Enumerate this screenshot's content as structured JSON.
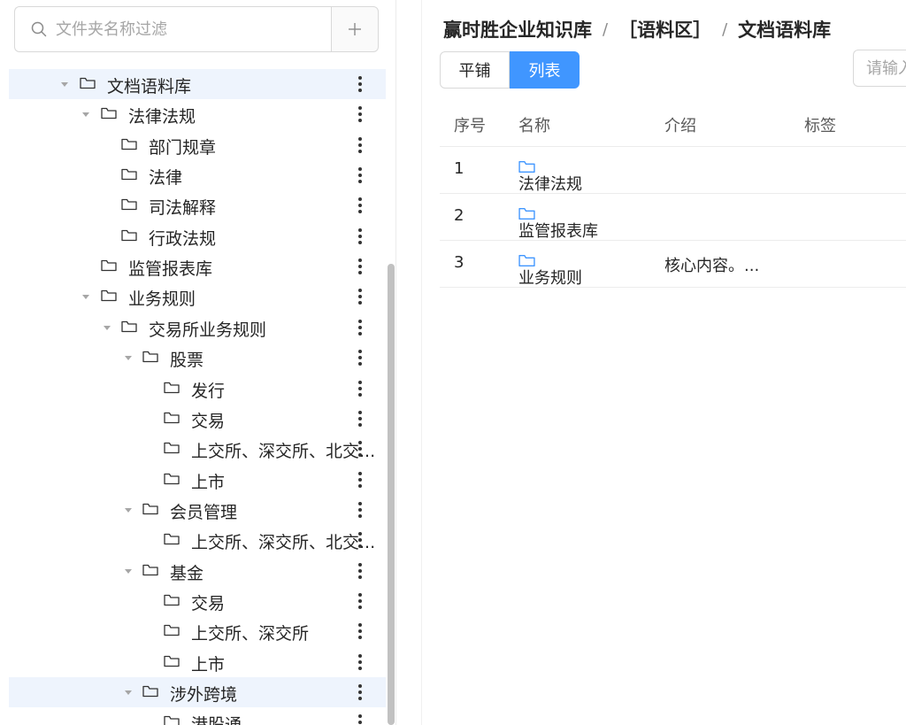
{
  "sidebar": {
    "search_placeholder": "文件夹名称过滤",
    "add_label": "+",
    "tree": [
      {
        "label": "文档语料库",
        "caret": true,
        "selected": true
      },
      {
        "label": "法律法规",
        "caret": true
      },
      {
        "label": "部门规章"
      },
      {
        "label": "法律"
      },
      {
        "label": "司法解释"
      },
      {
        "label": "行政法规"
      },
      {
        "label": "监管报表库"
      },
      {
        "label": "业务规则",
        "caret": true
      },
      {
        "label": "交易所业务规则",
        "caret": true
      },
      {
        "label": "股票",
        "caret": true
      },
      {
        "label": "发行"
      },
      {
        "label": "交易"
      },
      {
        "label": "上交所、深交所、北交...",
        "truncated": true
      },
      {
        "label": "上市"
      },
      {
        "label": "会员管理",
        "caret": true
      },
      {
        "label": "上交所、深交所、北交...",
        "truncated": true
      },
      {
        "label": "基金",
        "caret": true
      },
      {
        "label": "交易"
      },
      {
        "label": "上交所、深交所"
      },
      {
        "label": "上市"
      },
      {
        "label": "涉外跨境",
        "caret": true,
        "selected": true
      },
      {
        "label": "港股通"
      }
    ]
  },
  "main": {
    "breadcrumb": [
      "赢时胜企业知识库",
      "［语料区］",
      "文档语料库"
    ],
    "breadcrumb_sep": "/",
    "view_toggle": {
      "tile": "平铺",
      "list": "列表"
    },
    "filter_placeholder": "请输入",
    "table": {
      "headers": {
        "index": "序号",
        "name": "名称",
        "intro": "介绍",
        "tags": "标签"
      },
      "rows": [
        {
          "index": "1",
          "name": "法律法规",
          "intro": "",
          "tags": ""
        },
        {
          "index": "2",
          "name": "监管报表库",
          "intro": "",
          "tags": ""
        },
        {
          "index": "3",
          "name": "业务规则",
          "intro": "核心内容。...",
          "tags": ""
        }
      ]
    }
  },
  "colors": {
    "accent": "#4096ff",
    "selected_bg": "#eef4fd",
    "folder_icon": "#4096ff"
  }
}
